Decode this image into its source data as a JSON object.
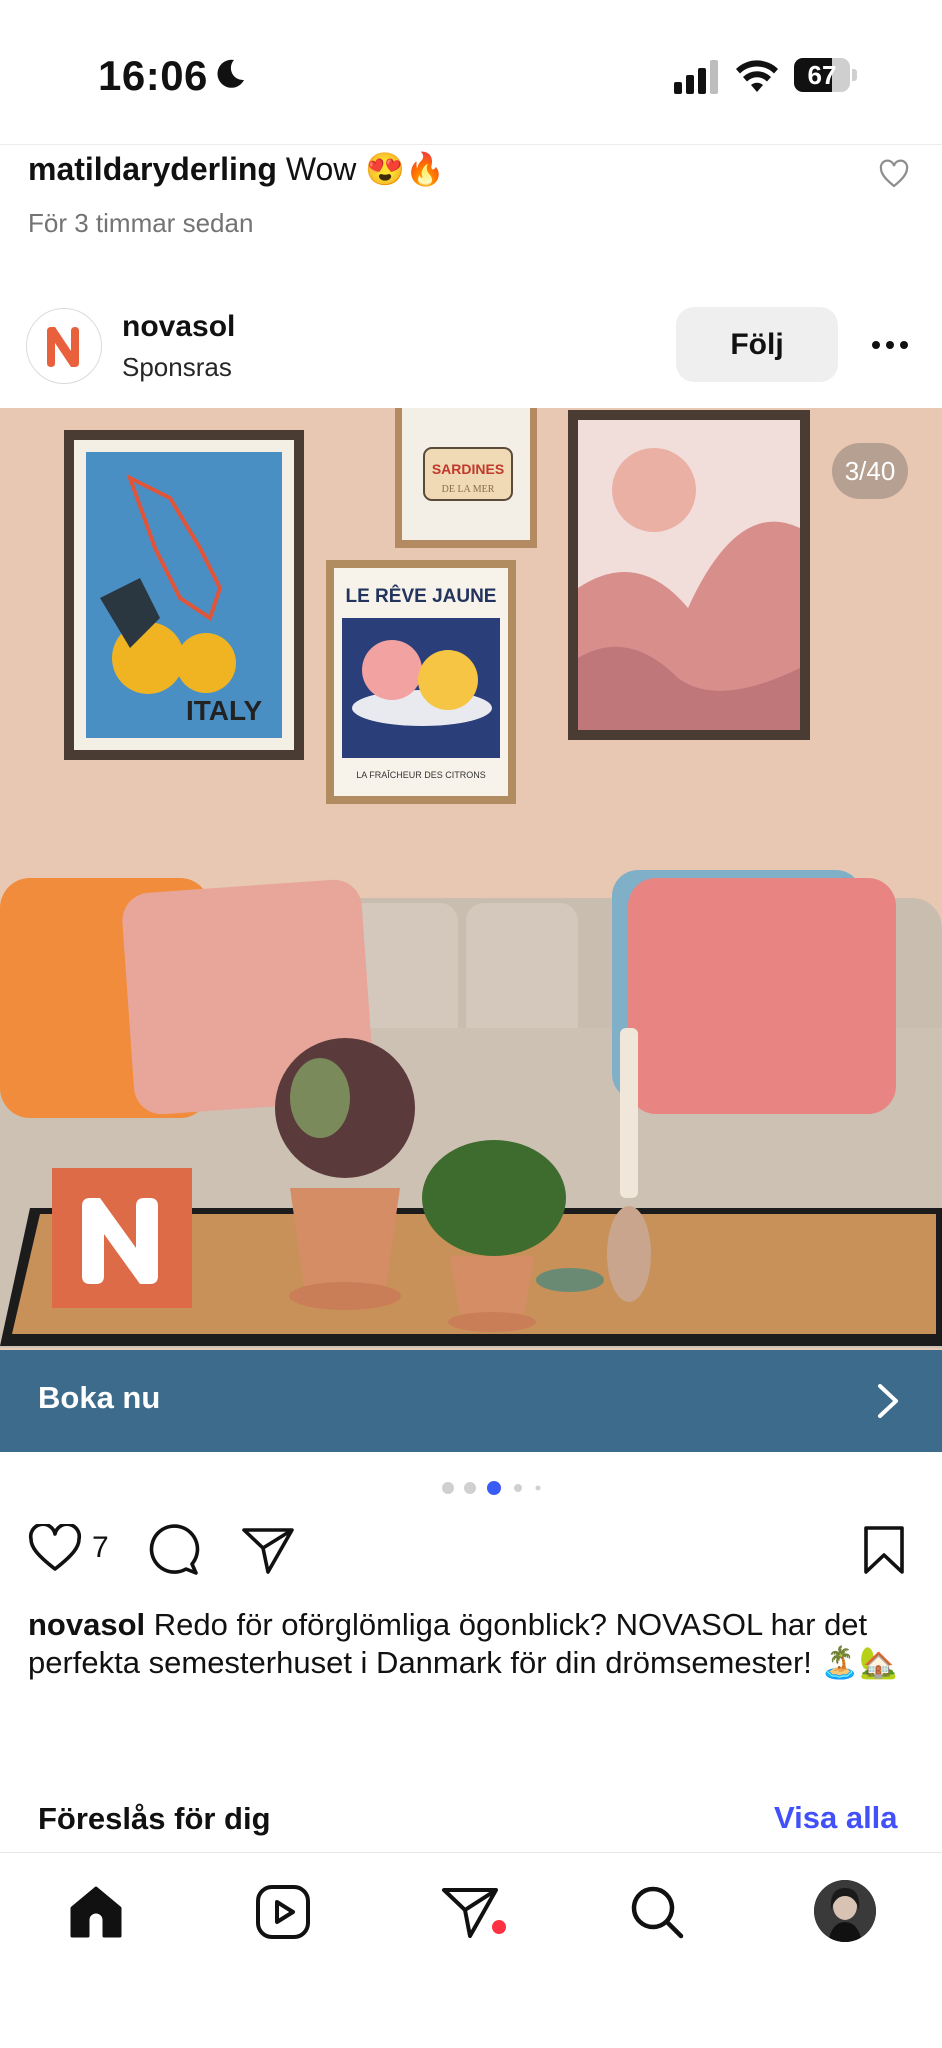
{
  "status_bar": {
    "time": "16:06",
    "battery": "67",
    "battery_level": 0.67
  },
  "previous_comment": {
    "username": "matildaryderling",
    "text": "Wow 😍🔥",
    "time_ago": "För 3 timmar sedan"
  },
  "post": {
    "username": "novasol",
    "sponsored_label": "Sponsras",
    "follow_label": "Följ",
    "image_counter": "3/40",
    "cta_label": "Boka nu",
    "like_count": "7",
    "caption_text": "Redo för oförglömliga ögonblick? NOVASOL har det perfekta semesterhuset i Danmark för din drömsemester! 🏝️🏡",
    "carousel_active_index": 2,
    "carousel_visible_dots": 5,
    "artwork": {
      "poster_italy": "ITALY",
      "poster_sardines": "SARDINES",
      "poster_sardines_sub": "DE LA MER",
      "poster_reve": "LE RÊVE JAUNE",
      "poster_reve_sub": "LA FRAÎCHEUR DES CITRONS"
    }
  },
  "suggested": {
    "title": "Föreslås för dig",
    "see_all": "Visa alla"
  },
  "colors": {
    "cta": "#3d6b8c",
    "brand": "#dd6b47",
    "link": "#4150f7",
    "notification": "#ff3040"
  }
}
